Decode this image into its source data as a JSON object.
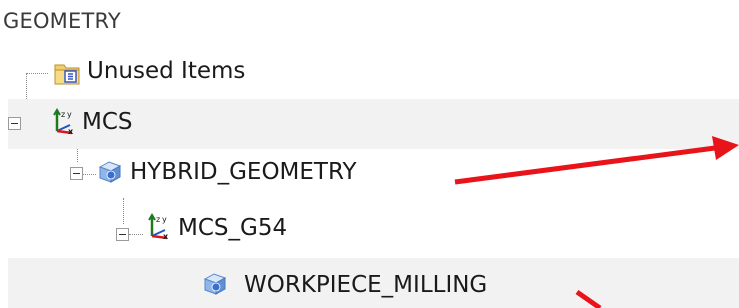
{
  "header": {
    "title": "GEOMETRY"
  },
  "tree": {
    "items": [
      {
        "label": "Unused Items",
        "icon": "folder-icon"
      },
      {
        "label": "MCS",
        "icon": "coordinate-system-icon",
        "expanded": true
      },
      {
        "label": "HYBRID_GEOMETRY",
        "icon": "geometry-block-icon",
        "expanded": true
      },
      {
        "label": "MCS_G54",
        "icon": "coordinate-system-icon",
        "expanded": true
      },
      {
        "label": "WORKPIECE_MILLING",
        "icon": "geometry-block-icon"
      }
    ]
  },
  "annotation": {
    "arrow_color": "#e8141a"
  }
}
